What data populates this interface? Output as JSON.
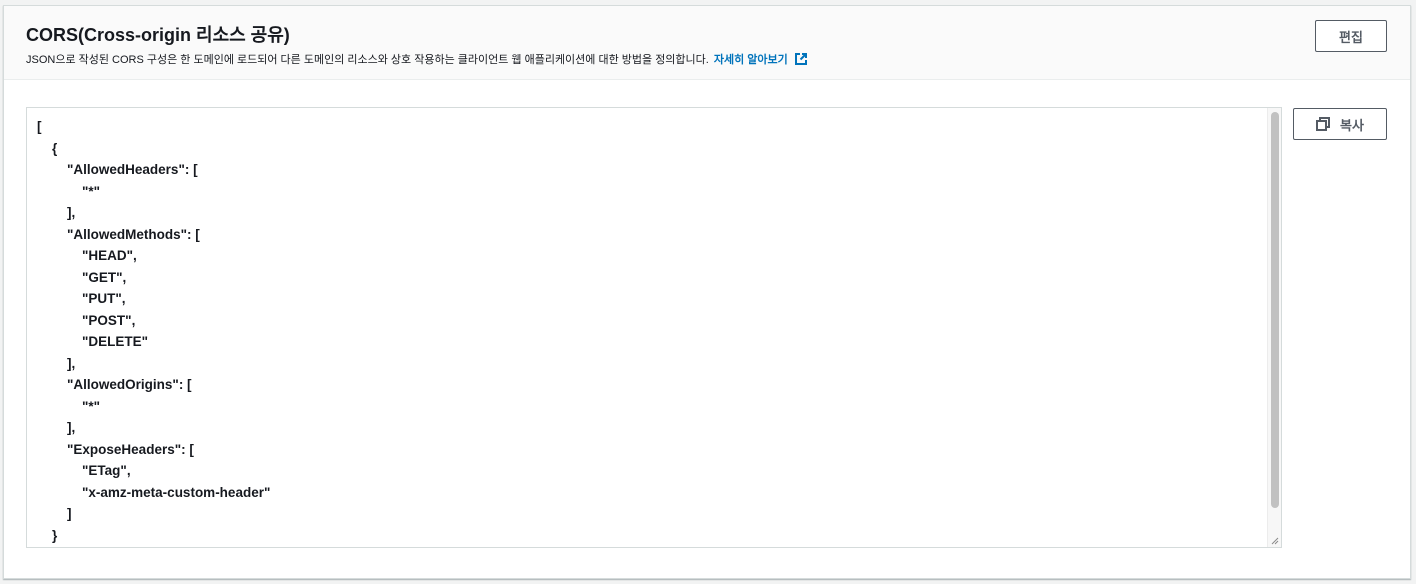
{
  "header": {
    "title": "CORS(Cross-origin 리소스 공유)",
    "description": "JSON으로 작성된 CORS 구성은 한 도메인에 로드되어 다른 도메인의 리소스와 상호 작용하는 클라이언트 웹 애플리케이션에 대한 방법을 정의합니다.",
    "learn_more_label": "자세히 알아보기",
    "learn_more_icon": "external-link-icon",
    "edit_label": "편집"
  },
  "editor": {
    "copy_label": "복사",
    "copy_icon": "copy-icon",
    "lines": [
      "[",
      "    {",
      "        \"AllowedHeaders\": [",
      "            \"*\"",
      "        ],",
      "        \"AllowedMethods\": [",
      "            \"HEAD\",",
      "            \"GET\",",
      "            \"PUT\",",
      "            \"POST\",",
      "            \"DELETE\"",
      "        ],",
      "        \"AllowedOrigins\": [",
      "            \"*\"",
      "        ],",
      "        \"ExposeHeaders\": [",
      "            \"ETag\",",
      "            \"x-amz-meta-custom-header\"",
      "        ]",
      "    }"
    ]
  },
  "colors": {
    "link": "#0073bb",
    "text": "#16191f",
    "button_border": "#545b64",
    "panel_bg": "#fafafa"
  }
}
